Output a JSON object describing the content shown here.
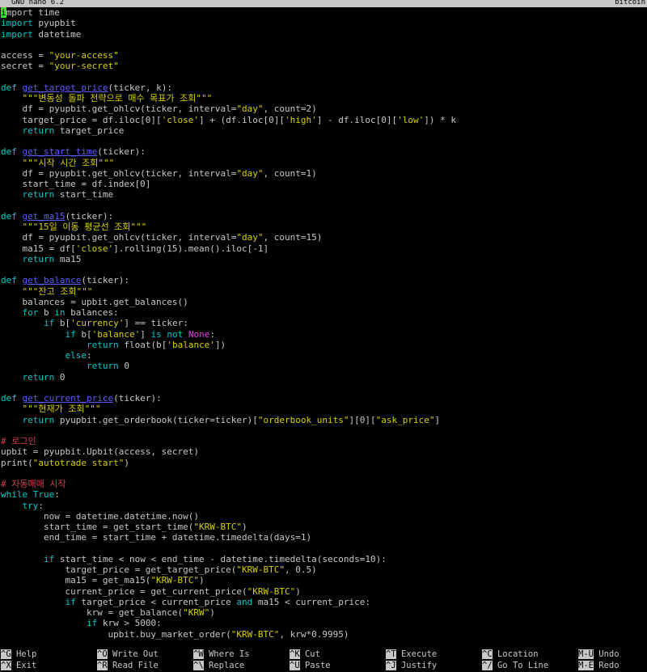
{
  "title_bar": {
    "app": "GNU nano 6.2",
    "file": "bitcoin"
  },
  "code": [
    [
      [
        "k",
        "i"
      ],
      [
        "t",
        "mport time"
      ]
    ],
    [
      [
        "k",
        "import"
      ],
      [
        "t",
        " pyupbit"
      ]
    ],
    [
      [
        "k",
        "import"
      ],
      [
        "t",
        " datetime"
      ]
    ],
    [],
    [
      [
        "t",
        "access = "
      ],
      [
        "s",
        "\"your-access\""
      ]
    ],
    [
      [
        "t",
        "secret = "
      ],
      [
        "s",
        "\"your-secret\""
      ]
    ],
    [],
    [
      [
        "k",
        "def"
      ],
      [
        "t",
        " "
      ],
      [
        "f",
        "get_target_price"
      ],
      [
        "t",
        "(ticker, k):"
      ]
    ],
    [
      [
        "t",
        "    "
      ],
      [
        "d",
        "\"\"\"변동성 돌파 전략으로 매수 목표가 조회\"\"\""
      ]
    ],
    [
      [
        "t",
        "    df = pyupbit.get_ohlcv(ticker, interval="
      ],
      [
        "s",
        "\"day\""
      ],
      [
        "t",
        ", count=2)"
      ]
    ],
    [
      [
        "t",
        "    target_price = df.iloc[0]["
      ],
      [
        "s",
        "'close'"
      ],
      [
        "t",
        "] + (df.iloc[0]["
      ],
      [
        "s",
        "'high'"
      ],
      [
        "t",
        "] - df.iloc[0]["
      ],
      [
        "s",
        "'low'"
      ],
      [
        "t",
        "]) * k"
      ]
    ],
    [
      [
        "t",
        "    "
      ],
      [
        "k",
        "return"
      ],
      [
        "t",
        " target_price"
      ]
    ],
    [],
    [
      [
        "k",
        "def"
      ],
      [
        "t",
        " "
      ],
      [
        "f",
        "get_start_time"
      ],
      [
        "t",
        "(ticker):"
      ]
    ],
    [
      [
        "t",
        "    "
      ],
      [
        "d",
        "\"\"\"시작 시간 조회\"\"\""
      ]
    ],
    [
      [
        "t",
        "    df = pyupbit.get_ohlcv(ticker, interval="
      ],
      [
        "s",
        "\"day\""
      ],
      [
        "t",
        ", count=1)"
      ]
    ],
    [
      [
        "t",
        "    start_time = df.index[0]"
      ]
    ],
    [
      [
        "t",
        "    "
      ],
      [
        "k",
        "return"
      ],
      [
        "t",
        " start_time"
      ]
    ],
    [],
    [
      [
        "k",
        "def"
      ],
      [
        "t",
        " "
      ],
      [
        "f",
        "get_ma15"
      ],
      [
        "t",
        "(ticker):"
      ]
    ],
    [
      [
        "t",
        "    "
      ],
      [
        "d",
        "\"\"\"15일 이동 평균선 조회\"\"\""
      ]
    ],
    [
      [
        "t",
        "    df = pyupbit.get_ohlcv(ticker, interval="
      ],
      [
        "s",
        "\"day\""
      ],
      [
        "t",
        ", count=15)"
      ]
    ],
    [
      [
        "t",
        "    ma15 = df["
      ],
      [
        "s",
        "'close'"
      ],
      [
        "t",
        "].rolling(15).mean().iloc[-1]"
      ]
    ],
    [
      [
        "t",
        "    "
      ],
      [
        "k",
        "return"
      ],
      [
        "t",
        " ma15"
      ]
    ],
    [],
    [
      [
        "k",
        "def"
      ],
      [
        "t",
        " "
      ],
      [
        "f",
        "get_balance"
      ],
      [
        "t",
        "(ticker):"
      ]
    ],
    [
      [
        "t",
        "    "
      ],
      [
        "d",
        "\"\"\"잔고 조회\"\"\""
      ]
    ],
    [
      [
        "t",
        "    balances = upbit.get_balances()"
      ]
    ],
    [
      [
        "t",
        "    "
      ],
      [
        "k",
        "for"
      ],
      [
        "t",
        " b "
      ],
      [
        "k",
        "in"
      ],
      [
        "t",
        " balances:"
      ]
    ],
    [
      [
        "t",
        "        "
      ],
      [
        "k",
        "if"
      ],
      [
        "t",
        " b["
      ],
      [
        "s",
        "'currency'"
      ],
      [
        "t",
        "] == ticker:"
      ]
    ],
    [
      [
        "t",
        "            "
      ],
      [
        "k",
        "if"
      ],
      [
        "t",
        " b["
      ],
      [
        "s",
        "'balance'"
      ],
      [
        "t",
        "] "
      ],
      [
        "k",
        "is not"
      ],
      [
        "t",
        " "
      ],
      [
        "c",
        "None"
      ],
      [
        "t",
        ":"
      ]
    ],
    [
      [
        "t",
        "                "
      ],
      [
        "k",
        "return"
      ],
      [
        "t",
        " float(b["
      ],
      [
        "s",
        "'balance'"
      ],
      [
        "t",
        "])"
      ]
    ],
    [
      [
        "t",
        "            "
      ],
      [
        "k",
        "else"
      ],
      [
        "t",
        ":"
      ]
    ],
    [
      [
        "t",
        "                "
      ],
      [
        "k",
        "return"
      ],
      [
        "t",
        " 0"
      ]
    ],
    [
      [
        "t",
        "    "
      ],
      [
        "k",
        "return"
      ],
      [
        "t",
        " 0"
      ]
    ],
    [],
    [
      [
        "k",
        "def"
      ],
      [
        "t",
        " "
      ],
      [
        "f",
        "get_current_price"
      ],
      [
        "t",
        "(ticker):"
      ]
    ],
    [
      [
        "t",
        "    "
      ],
      [
        "d",
        "\"\"\"현재가 조회\"\"\""
      ]
    ],
    [
      [
        "t",
        "    "
      ],
      [
        "k",
        "return"
      ],
      [
        "t",
        " pyupbit.get_orderbook(ticker=ticker)["
      ],
      [
        "s",
        "\"orderbook_units\""
      ],
      [
        "t",
        "][0]["
      ],
      [
        "s",
        "\"ask_price\""
      ],
      [
        "t",
        "]"
      ]
    ],
    [],
    [
      [
        "m",
        "# 로그인"
      ]
    ],
    [
      [
        "t",
        "upbit = pyupbit.Upbit(access, secret)"
      ]
    ],
    [
      [
        "t",
        "print("
      ],
      [
        "s",
        "\"autotrade start\""
      ],
      [
        "t",
        ")"
      ]
    ],
    [],
    [
      [
        "m",
        "# 자동매매 시작"
      ]
    ],
    [
      [
        "k",
        "while"
      ],
      [
        "t",
        " "
      ],
      [
        "k",
        "True"
      ],
      [
        "t",
        ":"
      ]
    ],
    [
      [
        "t",
        "    "
      ],
      [
        "k",
        "try"
      ],
      [
        "t",
        ":"
      ]
    ],
    [
      [
        "t",
        "        now = datetime.datetime.now()"
      ]
    ],
    [
      [
        "t",
        "        start_time = get_start_time("
      ],
      [
        "s",
        "\"KRW-BTC\""
      ],
      [
        "t",
        ")"
      ]
    ],
    [
      [
        "t",
        "        end_time = start_time + datetime.timedelta(days=1)"
      ]
    ],
    [],
    [
      [
        "t",
        "        "
      ],
      [
        "k",
        "if"
      ],
      [
        "t",
        " start_time < now < end_time - datetime.timedelta(seconds=10):"
      ]
    ],
    [
      [
        "t",
        "            target_price = get_target_price("
      ],
      [
        "s",
        "\"KRW-BTC\""
      ],
      [
        "t",
        ", 0.5)"
      ]
    ],
    [
      [
        "t",
        "            ma15 = get_ma15("
      ],
      [
        "s",
        "\"KRW-BTC\""
      ],
      [
        "t",
        ")"
      ]
    ],
    [
      [
        "t",
        "            current_price = get_current_price("
      ],
      [
        "s",
        "\"KRW-BTC\""
      ],
      [
        "t",
        ")"
      ]
    ],
    [
      [
        "t",
        "            "
      ],
      [
        "k",
        "if"
      ],
      [
        "t",
        " target_price < current_price "
      ],
      [
        "k",
        "and"
      ],
      [
        "t",
        " ma15 < current_price:"
      ]
    ],
    [
      [
        "t",
        "                krw = get_balance("
      ],
      [
        "s",
        "\"KRW\""
      ],
      [
        "t",
        ")"
      ]
    ],
    [
      [
        "t",
        "                "
      ],
      [
        "k",
        "if"
      ],
      [
        "t",
        " krw > 5000:"
      ]
    ],
    [
      [
        "t",
        "                    upbit.buy_market_order("
      ],
      [
        "s",
        "\"KRW-BTC\""
      ],
      [
        "t",
        ", krw*0.9995)"
      ]
    ]
  ],
  "shortcuts": [
    {
      "key": "^G",
      "label": "Help"
    },
    {
      "key": "^O",
      "label": "Write Out"
    },
    {
      "key": "^W",
      "label": "Where Is"
    },
    {
      "key": "^K",
      "label": "Cut"
    },
    {
      "key": "^T",
      "label": "Execute"
    },
    {
      "key": "^C",
      "label": "Location"
    },
    {
      "key": "M-U",
      "label": "Undo"
    },
    {
      "key": "^X",
      "label": "Exit"
    },
    {
      "key": "^R",
      "label": "Read File"
    },
    {
      "key": "^\\",
      "label": "Replace"
    },
    {
      "key": "^U",
      "label": "Paste"
    },
    {
      "key": "^J",
      "label": "Justify"
    },
    {
      "key": "^/",
      "label": "Go To Line"
    },
    {
      "key": "M-E",
      "label": "Redo"
    }
  ]
}
